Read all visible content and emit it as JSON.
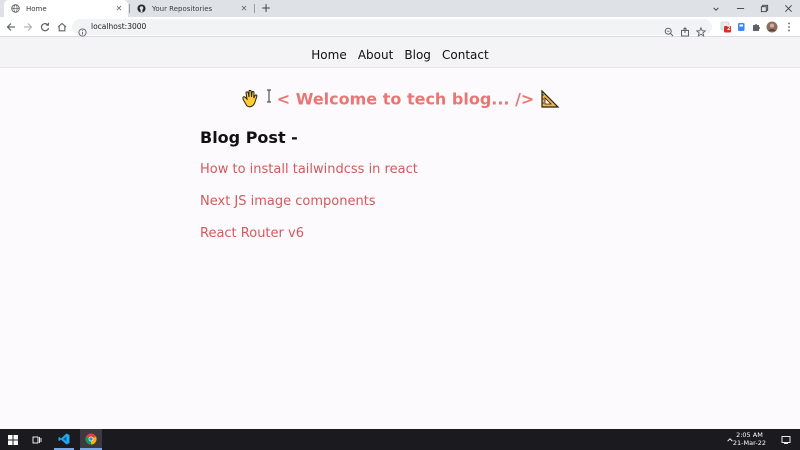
{
  "browser": {
    "tabs": [
      {
        "title": "Home",
        "active": true,
        "icon": "globe-icon"
      },
      {
        "title": "Your Repositories",
        "active": false,
        "icon": "github-icon"
      }
    ],
    "new_tab": "+",
    "address": "localhost:3000",
    "extension_badge": "2"
  },
  "site": {
    "nav": [
      "Home",
      "About",
      "Blog",
      "Contact"
    ],
    "welcome": "< Welcome to tech blog... />",
    "blog_heading": "Blog Post -",
    "posts": [
      "How to install tailwindcss in react",
      "Next JS image components",
      "React Router v6"
    ],
    "colors": {
      "accent": "#ea7572",
      "link": "#d25a5a",
      "nav_bg": "#f4f4f6"
    }
  },
  "taskbar": {
    "time": "2:05 AM",
    "date": "21-Mar-22"
  }
}
